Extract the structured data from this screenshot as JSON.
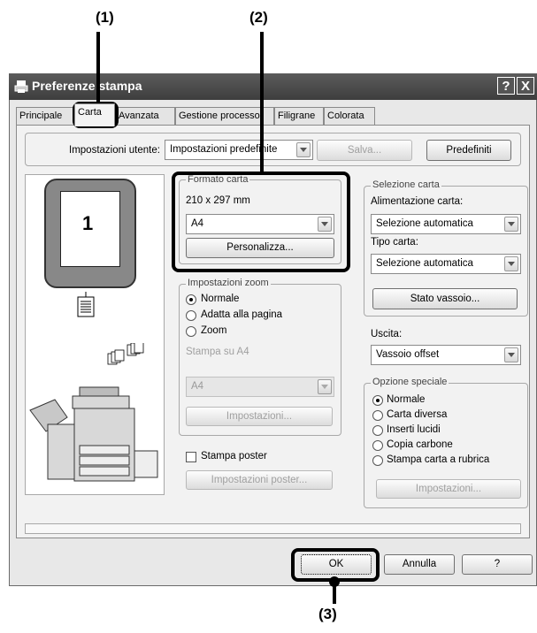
{
  "callouts": {
    "c1": "(1)",
    "c2": "(2)",
    "c3": "(3)"
  },
  "window": {
    "title": "Preferenze stampa",
    "help_button": "?",
    "close_button": "X"
  },
  "tabs": [
    {
      "label": "Principale"
    },
    {
      "label": "Carta"
    },
    {
      "label": "Avanzata"
    },
    {
      "label": "Gestione processo"
    },
    {
      "label": "Filigrane"
    },
    {
      "label": "Colorata"
    }
  ],
  "user_settings": {
    "label": "Impostazioni utente:",
    "value": "Impostazioni predefinite",
    "save_label": "Salva...",
    "defaults_label": "Predefiniti"
  },
  "preview": {
    "page_number": "1"
  },
  "paper_size": {
    "legend": "Formato carta",
    "dimensions": "210 x 297 mm",
    "value": "A4",
    "custom_label": "Personalizza..."
  },
  "zoom": {
    "legend": "Impostazioni zoom",
    "options": [
      "Normale",
      "Adatta alla pagina",
      "Zoom"
    ],
    "selected": "Normale",
    "print_on_label": "Stampa su A4",
    "print_on_value": "A4",
    "settings_label": "Impostazioni..."
  },
  "poster": {
    "checkbox_label": "Stampa poster",
    "checked": false,
    "settings_label": "Impostazioni poster..."
  },
  "paper_selection": {
    "legend": "Selezione carta",
    "source_label": "Alimentazione carta:",
    "source_value": "Selezione automatica",
    "type_label": "Tipo carta:",
    "type_value": "Selezione automatica",
    "tray_status_label": "Stato vassoio..."
  },
  "output": {
    "label": "Uscita:",
    "value": "Vassoio offset"
  },
  "special": {
    "legend": "Opzione speciale",
    "options": [
      "Normale",
      "Carta diversa",
      "Inserti lucidi",
      "Copia carbone",
      "Stampa carta a rubrica"
    ],
    "selected": "Normale",
    "settings_label": "Impostazioni..."
  },
  "footer": {
    "ok_label": "OK",
    "cancel_label": "Annulla",
    "help_label": "?"
  }
}
